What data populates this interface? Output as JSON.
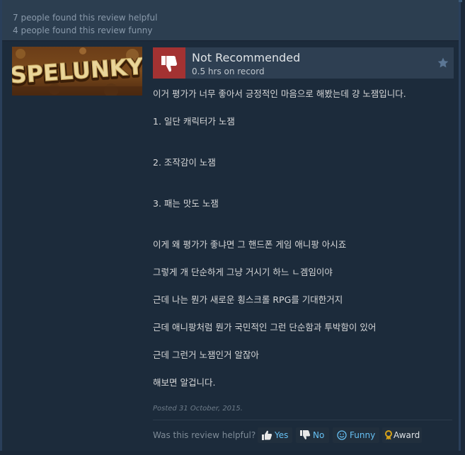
{
  "previous_review": {
    "helpful_text": "7 people found this review helpful",
    "funny_text": "4 people found this review funny"
  },
  "game": {
    "capsule_title": "SPELUNKY"
  },
  "review": {
    "verdict": "Not Recommended",
    "verdict_icon": "thumbs-down-icon",
    "hours": "0.5 hrs on record",
    "body_lines": [
      "이거 평가가 너무 좋아서 긍정적인 마음으로 해봤는데 걍 노잼입니다.",
      "1. 일단 캐릭터가 노잼",
      "2. 조작감이 노잼",
      "3. 패는 맛도 노잼",
      "이게 왜 평가가 좋냐면 그 핸드폰 게임 애니팡 아시죠",
      "그렇게 개 단순하게 그냥 거시기 하느 ㄴ겜임이야",
      "근데 나는 뭔가 새로운 횡스크롤 RPG를 기대한거지",
      "근데 애니팡처럼 뭔가 국민적인 그런 단순함과 투박함이 있어",
      "근데 그런거 노잼인거 알잖아",
      "해보면 알겁니다."
    ],
    "posted": "Posted 31 October, 2015."
  },
  "helpful": {
    "prompt": "Was this review helpful?",
    "yes_label": "Yes",
    "no_label": "No",
    "funny_label": "Funny",
    "award_label": "Award"
  },
  "colors": {
    "background": "#1b2838",
    "not_recommended": "#a33232",
    "link_blue": "#66c0f4",
    "award_gold": "#d4a21a"
  }
}
